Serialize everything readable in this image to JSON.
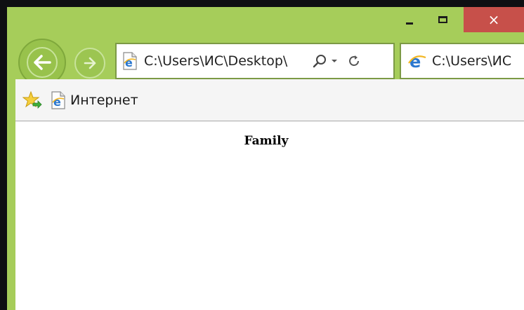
{
  "window": {
    "controls": {
      "minimize": "minimize",
      "maximize": "maximize",
      "close": "×"
    }
  },
  "navigation": {
    "address": "C:\\Users\\ИС\\Desktop\\"
  },
  "tab": {
    "label": "C:\\Users\\ИС"
  },
  "favorites_bar": {
    "item_label": "Интернет"
  },
  "page": {
    "heading": "Family"
  },
  "colors": {
    "frame": "#a6cd5a",
    "close_button": "#c7504a",
    "background": "#0e0f12",
    "ie_blue": "#2a77cf",
    "ie_ring": "#f2b623"
  },
  "icons": [
    "back-arrow-icon",
    "forward-arrow-icon",
    "ie-logo-icon",
    "search-icon",
    "dropdown-icon",
    "refresh-icon",
    "favorites-star-icon"
  ]
}
